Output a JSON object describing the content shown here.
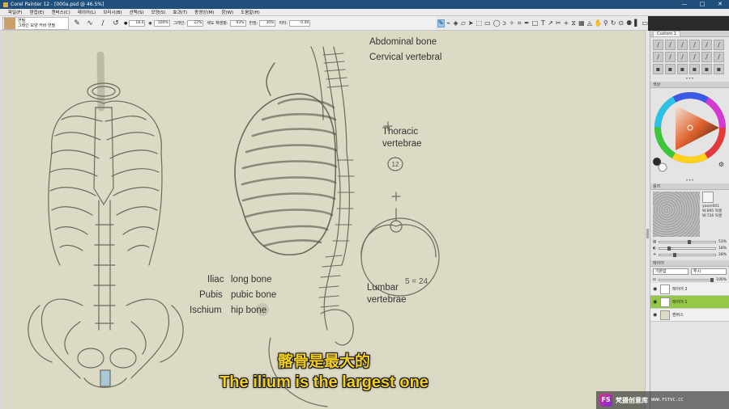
{
  "window": {
    "title": "Corel Painter 12 - [000a.psd @ 46.5%]",
    "controls": [
      "—",
      "□",
      "✕"
    ]
  },
  "menu": [
    "파일(F)",
    "편집(E)",
    "캔버스(C)",
    "레이어(L)",
    "브러시(B)",
    "선택(S)",
    "모양(S)",
    "효과(T)",
    "동영상(M)",
    "창(W)",
    "도움말(H)"
  ],
  "property_bar": {
    "brush_category": "연필",
    "brush_variant": "그레인 모양 커버 연필",
    "size_value": "18.4",
    "opacity_value": "100%",
    "grain_label": "그레인:",
    "grain_value": "22%",
    "smooth_label": "색도 재샘핑:",
    "smooth_value": "93%",
    "jitter_label": "번짐:",
    "jitter_value": "30%",
    "tilt_label": "지터:",
    "tilt_value": "0.00"
  },
  "canvas_labels": {
    "abdominal": "Abdominal bone",
    "cervical": "Cervical vertebral",
    "thoracic_1": "Thoracic",
    "thoracic_2": "vertebrae",
    "lumbar_1": "Lumbar",
    "lumbar_2": "vertebrae",
    "iliac": "Iliac",
    "long_bone": "long bone",
    "pubis": "Pubis",
    "pubic_bone": "pubic bone",
    "ischium": "Ischium",
    "hip_bone": "hip bone",
    "sketch_num": "5 = 24",
    "circle_num": "12"
  },
  "subtitles": {
    "chinese": "髂骨是最大的",
    "english": "The ilium is the largest one"
  },
  "panels": {
    "brushes_tab": "Custom 1",
    "color_title": "색상",
    "texture_title": "용지",
    "texture_name": "yoom001",
    "texture_w": "W:895 픽셀",
    "texture_h": "W:726 픽셀",
    "slider_vals": [
      "53%",
      "18%",
      "28%"
    ],
    "layers_title": "레이어",
    "blend_mode": "기본값",
    "composite": "투시",
    "layer_opacity": "100%",
    "layers": [
      {
        "name": "레이어 2",
        "selected": false
      },
      {
        "name": "레이어 1",
        "selected": true
      },
      {
        "name": "캔버스",
        "selected": false
      }
    ]
  },
  "watermark": {
    "logo": "FS",
    "text": "梵摄创意库",
    "url": "WWW.FSTVC.CC"
  },
  "colors": {
    "canvas_bg": "#dcd9c4",
    "subtitle": "#f2cf1e",
    "selected_layer": "#95c847",
    "titlebar": "#1f4f7a"
  }
}
